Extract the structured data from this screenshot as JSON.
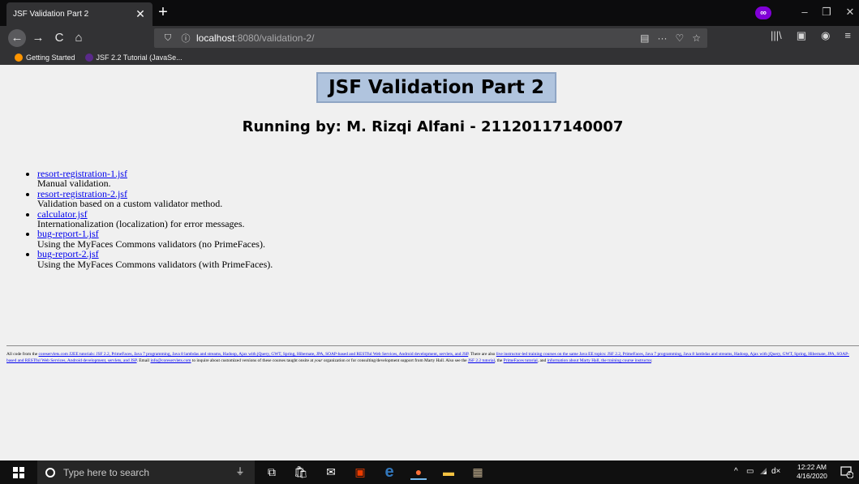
{
  "browser": {
    "tab_title": "JSF Validation Part 2",
    "tab_close": "✕",
    "new_tab": "+",
    "url_host": "localhost",
    "url_path": ":8080/validation-2/",
    "private_icon": "∞",
    "window_controls": {
      "minimize": "–",
      "restore": "❐",
      "close": "✕"
    },
    "nav": {
      "back": "←",
      "forward": "→",
      "reload": "C",
      "home": "⌂"
    },
    "url_icons": {
      "shield": "⛉",
      "info": "ⓘ",
      "reader": "▤",
      "more": "···",
      "pocket": "♡",
      "bookmark": "☆"
    },
    "toolbar_icons": {
      "library": "|||\\",
      "sidebar": "▣",
      "account": "◉",
      "menu": "≡"
    },
    "bookmarks": [
      {
        "label": "Getting Started",
        "icon": "firefox-icon",
        "color": "#ff9500"
      },
      {
        "label": "JSF 2.2 Tutorial (JavaSe...",
        "icon": "page-icon",
        "color": "#5a2a8a"
      }
    ]
  },
  "page": {
    "title": "JSF Validation Part 2",
    "subtitle": "Running by: M. Rizqi Alfani - 21120117140007",
    "items": [
      {
        "link": "resort-registration-1.jsf",
        "desc": "Manual validation."
      },
      {
        "link": "resort-registration-2.jsf",
        "desc": "Validation based on a custom validator method."
      },
      {
        "link": "calculator.jsf",
        "desc": "Internationalization (localization) for error messages."
      },
      {
        "link": "bug-report-1.jsf",
        "desc": "Using the MyFaces Commons validators (no PrimeFaces)."
      },
      {
        "link": "bug-report-2.jsf",
        "desc": "Using the MyFaces Commons validators (with PrimeFaces)."
      }
    ],
    "footer": {
      "t1": "All code from the ",
      "l1": "coreservlets.com J2EE tutorials: JSF 2.2, PrimeFaces, Java 7 programming, Java 8 lambdas and streams, Hadoop, Ajax with jQuery, GWT, Spring, Hibernate, JPA, SOAP-based and RESTful Web Services, Android development, servlets, and JSP",
      "t2": ". There are also ",
      "l2": "live instructor-led training courses on the same Java EE topics: JSF 2.2, PrimeFaces, Java 7 programming, Java 8 lambdas and streams, Hadoop, Ajax with jQuery, GWT, Spring, Hibernate, JPA, SOAP-based and RESTful Web Services, Android development, servlets, and JSP",
      "t3": ". Email ",
      "l3": "info@coreservlets.com",
      "t4": " to inquire about customized versions of these courses taught onsite at ",
      "t4i": "your",
      "t5": " organization or for consulting/development support from Marty Hall. Also see the ",
      "l4": "JSF 2.2 tutorial",
      "t6": ", the ",
      "l5": "PrimeFaces tutorial",
      "t7": ", and ",
      "l6": "information about Marty Hall, the training course instructor",
      "t8": "."
    }
  },
  "taskbar": {
    "search_placeholder": "Type here to search",
    "clock_time": "12:22 AM",
    "clock_date": "4/16/2020",
    "notification_count": "2",
    "tray": {
      "chevron": "^",
      "battery": "▭",
      "volume": "d×"
    },
    "apps": [
      {
        "name": "microphone-icon",
        "glyph": "⏚",
        "color": "#ffffff"
      },
      {
        "name": "task-view-icon",
        "glyph": "⧉",
        "color": "#ffffff"
      },
      {
        "name": "store-icon",
        "glyph": "🛍",
        "color": "#ffffff"
      },
      {
        "name": "mail-icon",
        "glyph": "✉",
        "color": "#ffffff"
      },
      {
        "name": "office-icon",
        "glyph": "▣",
        "color": "#eb3c00"
      },
      {
        "name": "edge-icon",
        "glyph": "e",
        "color": "#3277bc"
      },
      {
        "name": "firefox-icon",
        "glyph": "●",
        "color": "#ff7139"
      },
      {
        "name": "file-explorer-icon",
        "glyph": "▬",
        "color": "#f4c242"
      },
      {
        "name": "app-icon",
        "glyph": "▦",
        "color": "#b9a88a"
      }
    ]
  }
}
